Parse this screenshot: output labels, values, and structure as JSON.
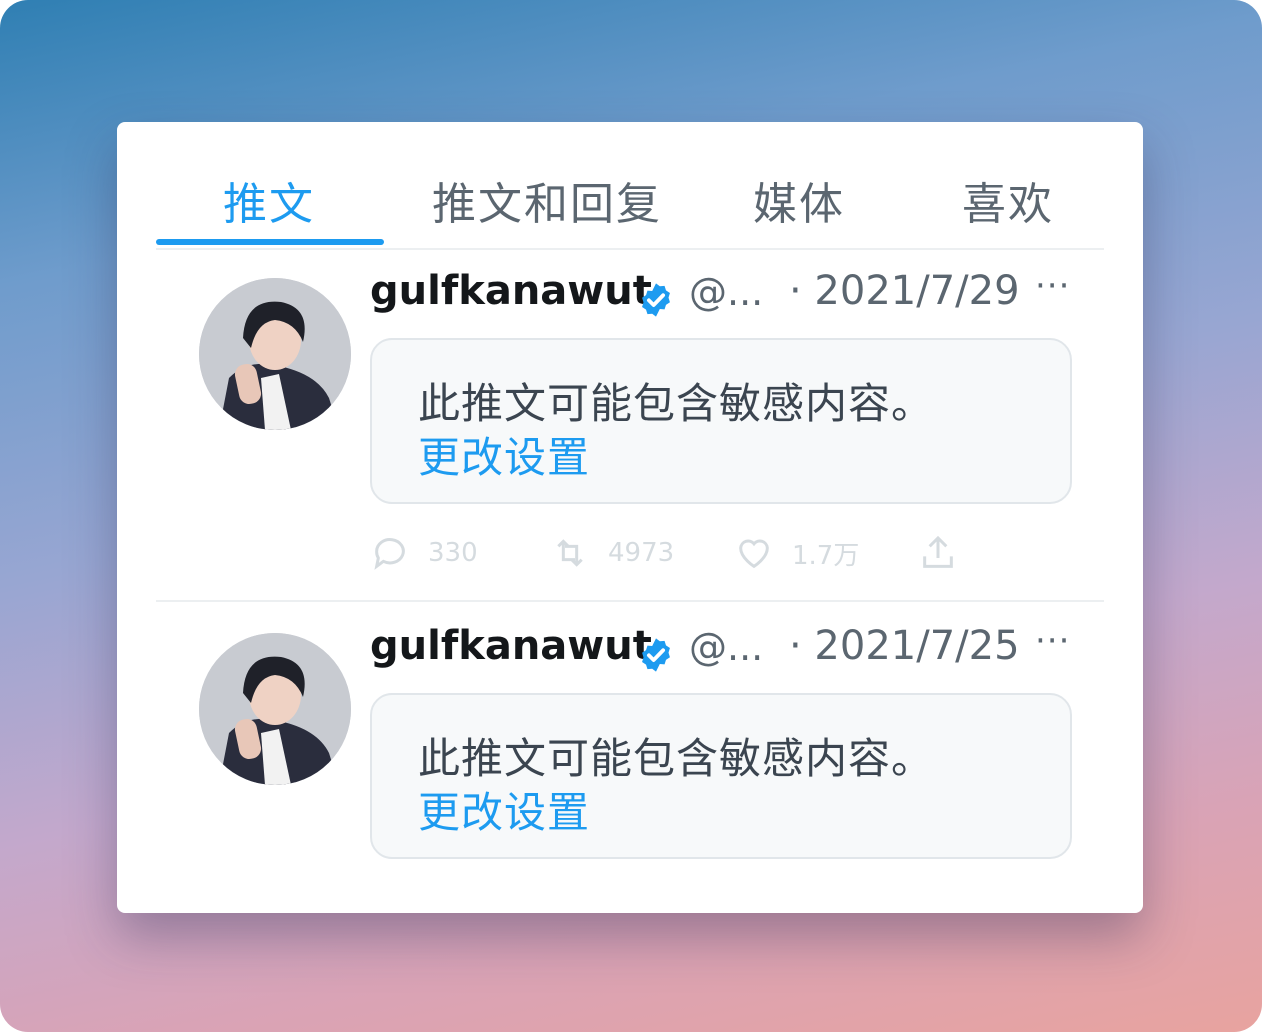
{
  "tabs": [
    {
      "label": "推文",
      "active": true
    },
    {
      "label": "推文和回复",
      "active": false
    },
    {
      "label": "媒体",
      "active": false
    },
    {
      "label": "喜欢",
      "active": false
    }
  ],
  "tweets": [
    {
      "name": "gulfkanawut",
      "handle": "@...",
      "date": "· 2021/7/29",
      "more": "···",
      "notice_text": "此推文可能包含敏感内容。",
      "notice_link": "更改设置",
      "actions": {
        "reply": "330",
        "retweet": "4973",
        "like": "1.7万"
      }
    },
    {
      "name": "gulfkanawut",
      "handle": "@...",
      "date": "· 2021/7/25",
      "more": "···",
      "notice_text": "此推文可能包含敏感内容。",
      "notice_link": "更改设置"
    }
  ],
  "colors": {
    "accent": "#1d9bf0",
    "verified": "#1d9bf0",
    "text": "#14171a",
    "muted": "#5b6670"
  }
}
